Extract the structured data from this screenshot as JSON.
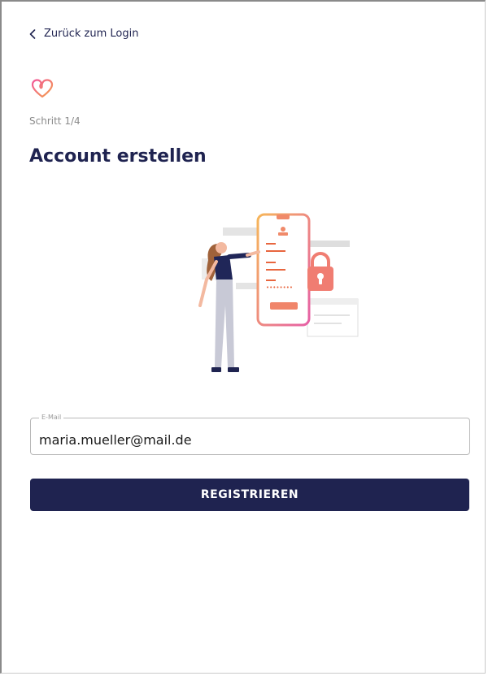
{
  "nav": {
    "back_label": "Zurück zum Login",
    "back_icon": "chevron-left-icon"
  },
  "brand": {
    "logo_icon": "heart-logo-icon",
    "accent_gradient": [
      "#f26b5b",
      "#f3a04a"
    ]
  },
  "header": {
    "step": "Schritt 1/4",
    "title": "Account erstellen"
  },
  "form": {
    "email_label": "E-Mail",
    "email_value": "maria.mueller@mail.de",
    "submit_label": "REGISTRIEREN"
  },
  "colors": {
    "primary": "#1f2350",
    "accent": "#f26b5b",
    "muted": "#8a8a8a"
  }
}
